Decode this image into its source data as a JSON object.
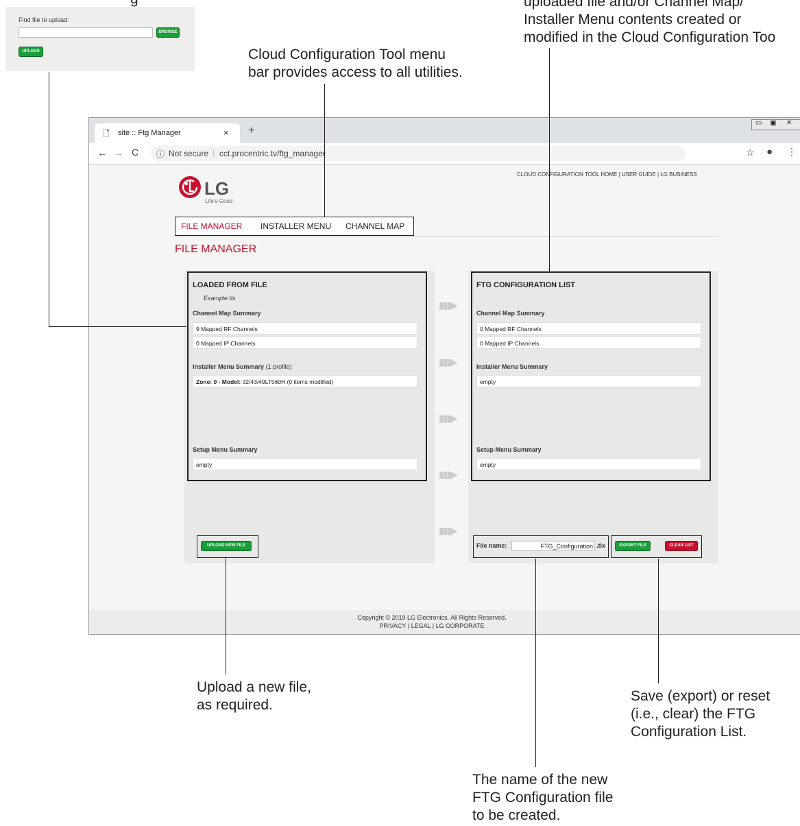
{
  "callouts": {
    "upload_inset_title_fragment": "g",
    "menu_bar": [
      "Cloud Configuration Tool menu",
      "bar provides access to all utilities."
    ],
    "ftg_list": [
      "uploaded file and/or Channel Map/",
      "Installer Menu contents created or",
      "modified in the Cloud Configuration Too"
    ],
    "upload_new": [
      "Upload a new file,",
      "as required."
    ],
    "file_name": [
      "The name of the new",
      "FTG Configuration file",
      "to be created."
    ],
    "export_clear": [
      "Save (export) or reset",
      "(i.e., clear) the FTG",
      "Configuration List."
    ]
  },
  "upload_inset": {
    "label": "Find file to upload:",
    "browse_label": "BROWSE",
    "upload_label": "UPLOAD"
  },
  "browser": {
    "tab_title": "site :: Ftg Manager",
    "tab_close": "×",
    "new_tab": "+",
    "not_secure": "Not secure",
    "url": "cct.procentric.tv/ftg_manager"
  },
  "header": {
    "links": [
      "CLOUD CONFIGURATION TOOL HOME",
      "USER GUIDE",
      "LG BUSINESS"
    ],
    "logo_text": "LG",
    "tagline": "Life's Good"
  },
  "menu": {
    "items": [
      "FILE MANAGER",
      "INSTALLER MENU",
      "CHANNEL MAP"
    ],
    "active_index": 0
  },
  "page_title": "FILE MANAGER",
  "left_panel": {
    "title": "LOADED FROM FILE",
    "filename": "Example.tlx",
    "channel_map_label": "Channel Map Summary",
    "rf": "9 Mapped RF Channels",
    "ip": "0 Mapped IP Channels",
    "installer_label": "Installer Menu Summary",
    "installer_profiles": "(1 profile)",
    "zone_bold": "Zone: 0 - Model:",
    "zone_rest": "32/43/49LT560H (0 items modified)",
    "setup_label": "Setup Menu Summary",
    "setup_value": "empty",
    "upload_new_label": "UPLOAD NEW FILE"
  },
  "right_panel": {
    "title": "FTG CONFIGURATION LIST",
    "channel_map_label": "Channel Map Summary",
    "rf": "0 Mapped RF Channels",
    "ip": "0 Mapped IP Channels",
    "installer_label": "Installer Menu Summary",
    "installer_value": "empty",
    "setup_label": "Setup Menu Summary",
    "setup_value": "empty",
    "file_name_label": "File name:",
    "file_name_value": "FTG_Configuration",
    "file_ext": ".tlx",
    "export_label": "EXPORT FILE",
    "clear_label": "CLEAR LIST"
  },
  "footer": {
    "copyright": "Copyright © 2019 LG Electronics. All Rights Reserved.",
    "links": [
      "PRIVACY",
      "LEGAL",
      "LG CORPORATE"
    ]
  },
  "colors": {
    "lg_red": "#c8102e",
    "green": "#1a9e3a",
    "panel": "#e8e8e6"
  }
}
